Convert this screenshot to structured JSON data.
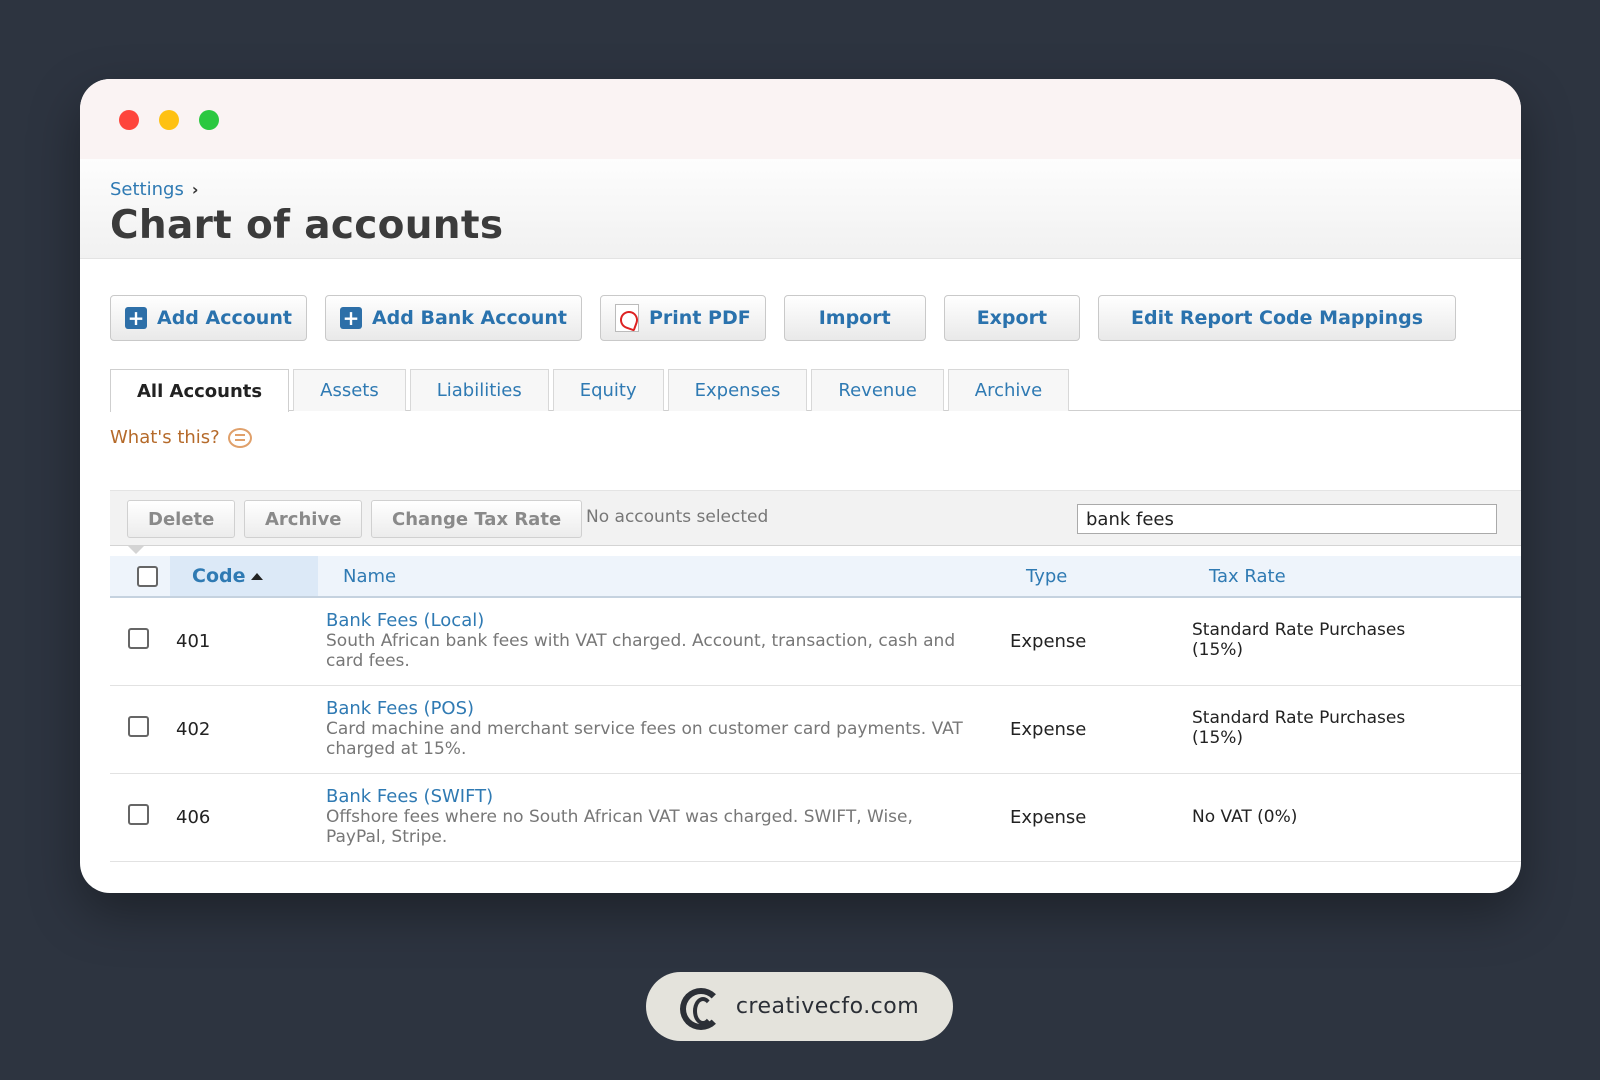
{
  "breadcrumb": {
    "parent": "Settings",
    "separator": "›"
  },
  "page": {
    "title": "Chart of accounts"
  },
  "toolbar": {
    "add_account": "Add Account",
    "add_bank_account": "Add Bank Account",
    "print_pdf": "Print PDF",
    "import": "Import",
    "export": "Export",
    "edit_mappings": "Edit Report Code Mappings"
  },
  "tabs": [
    "All Accounts",
    "Assets",
    "Liabilities",
    "Equity",
    "Expenses",
    "Revenue",
    "Archive"
  ],
  "whats_this": "What's this?",
  "actions": {
    "delete": "Delete",
    "archive": "Archive",
    "change_tax_rate": "Change Tax Rate",
    "status": "No accounts selected",
    "search_value": "bank fees"
  },
  "table": {
    "headers": {
      "code": "Code",
      "name": "Name",
      "type": "Type",
      "tax_rate": "Tax Rate"
    },
    "rows": [
      {
        "code": "401",
        "name": "Bank Fees (Local)",
        "description": "South African bank fees with VAT charged. Account, transaction, cash and card fees.",
        "type": "Expense",
        "tax_rate": "Standard Rate Purchases (15%)"
      },
      {
        "code": "402",
        "name": "Bank Fees (POS)",
        "description": "Card machine and merchant service fees on customer card payments. VAT charged at 15%.",
        "type": "Expense",
        "tax_rate": "Standard Rate Purchases (15%)"
      },
      {
        "code": "406",
        "name": "Bank Fees (SWIFT)",
        "description": "Offshore fees where no South African VAT was charged. SWIFT, Wise, PayPal, Stripe.",
        "type": "Expense",
        "tax_rate": "No VAT (0%)"
      }
    ]
  },
  "footer": {
    "brand": "creativecfo.com"
  },
  "icons": {
    "add": "plus-square-icon",
    "pdf": "pdf-icon",
    "help": "speech-bubble-icon",
    "sort": "sort-ascending-icon",
    "brand": "creativecfo-logo-icon"
  },
  "colors": {
    "background": "#2d3440",
    "link": "#2f7ab3",
    "window_close": "#fe453c",
    "window_minimize": "#fec113",
    "window_zoom": "#2bc840"
  }
}
